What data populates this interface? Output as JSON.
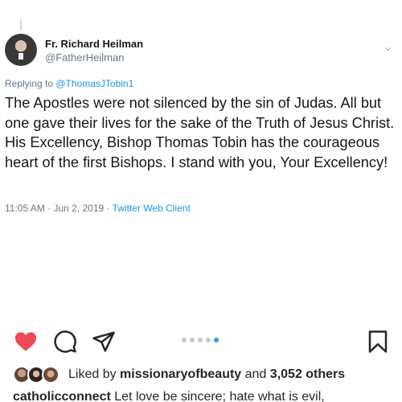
{
  "tweet": {
    "display_name": "Fr. Richard Heilman",
    "handle": "@FatherHeilman",
    "replying_prefix": "Replying to ",
    "replying_to": "@ThomasJTobin1",
    "text": "The Apostles were not silenced by the sin of Judas. All but one gave their lives for the sake of the Truth of Jesus Christ. His Excellency, Bishop Thomas Tobin has the courageous heart of the first Bishops. I stand with you, Your Excellency!",
    "timestamp": "11:05 AM · Jun 2, 2019 · ",
    "client": "Twitter Web Client"
  },
  "actions": {
    "like_icon": "heart-icon",
    "comment_icon": "comment-icon",
    "share_icon": "paper-plane-icon",
    "save_icon": "bookmark-icon",
    "like_color": "#ed4956"
  },
  "carousel": {
    "total": 5,
    "active_index": 4
  },
  "likes": {
    "prefix": "Liked by ",
    "user": "missionaryofbeauty",
    "middle": " and ",
    "count": "3,052 others"
  },
  "caption": {
    "username": "catholicconnect",
    "text": " Let love be sincere; hate what is evil,"
  }
}
